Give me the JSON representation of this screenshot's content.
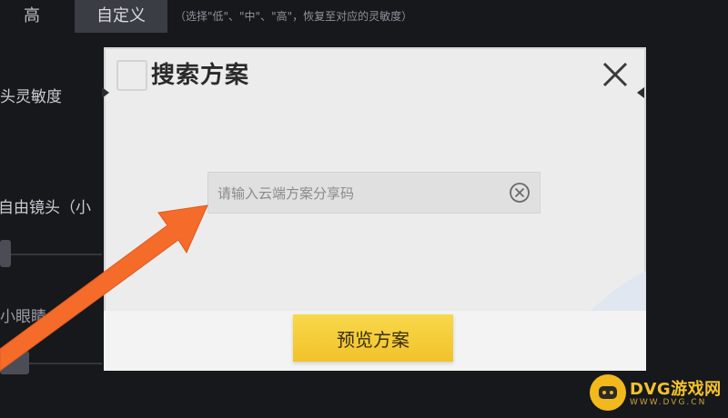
{
  "background": {
    "tabs": [
      {
        "label": "高"
      },
      {
        "label": "自定义"
      }
    ],
    "hint": "（选择\"低\"、\"中\"、\"高\"，恢复至对应的灵敏度）",
    "rows": [
      {
        "label": "头灵敏度"
      },
      {
        "label": "自由镜头（小"
      },
      {
        "label": "小眼睛"
      }
    ]
  },
  "dialog": {
    "title": "搜索方案",
    "search": {
      "placeholder": "请输入云端方案分享码",
      "value": ""
    },
    "preview_button": "预览方案"
  },
  "watermark": {
    "brand": "DVG游戏网",
    "url": "WWW.DVG.CN"
  },
  "colors": {
    "accent_yellow": "#f1c22b",
    "arrow_orange": "#f46b2a",
    "dialog_bg": "#ececec"
  }
}
